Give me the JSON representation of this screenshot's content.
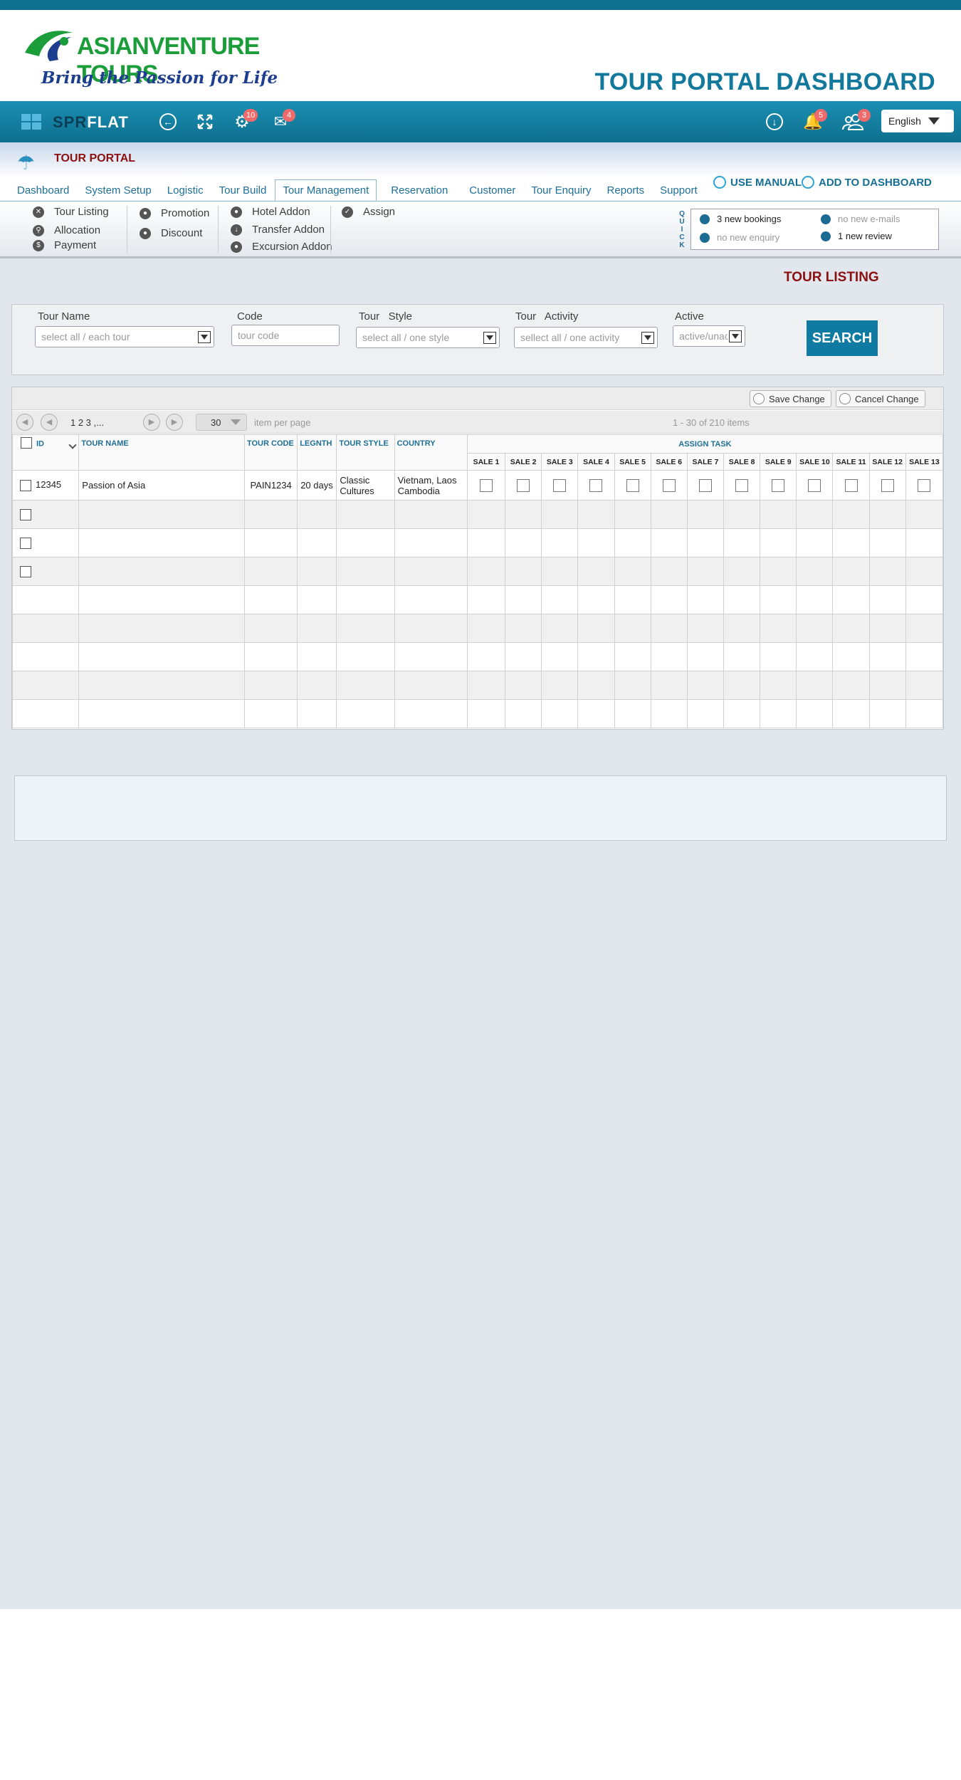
{
  "brand": {
    "logo_text": "ASIANVENTURE TOURS",
    "tagline": "Bring the Passion for Life",
    "dashboard_title": "TOUR PORTAL DASHBOARD"
  },
  "navbar": {
    "app_name_a": "SPR",
    "app_name_b": "FLAT",
    "settings_badge": "10",
    "mail_badge": "4",
    "notifications_badge": "5",
    "users_badge": "3",
    "language": "English"
  },
  "portal": {
    "label": "TOUR PORTAL",
    "tabs": [
      "Dashboard",
      "System Setup",
      "Logistic",
      "Tour Build",
      "Tour Management",
      "Reservation",
      "Customer",
      "Tour Enquiry",
      "Reports",
      "Support"
    ],
    "active_tab": "Tour Management",
    "use_manual": "USE MANUAL",
    "add_to_dashboard": "ADD TO  DASHBOARD"
  },
  "submenu": {
    "col1": [
      "Tour Listing",
      "Allocation",
      "Payment"
    ],
    "col2": [
      "Promotion",
      "Discount"
    ],
    "col3": [
      "Hotel Addon",
      "Transfer Addon",
      "Excursion Addon"
    ],
    "col4": [
      "Assign"
    ]
  },
  "quick": {
    "label": "QUICK",
    "items": [
      "3 new bookings",
      "no new e-mails",
      "no new enquiry",
      "1 new review"
    ]
  },
  "page": {
    "title": "TOUR LISTING"
  },
  "filters": {
    "tour_name_label": "Tour Name",
    "tour_name_value": "select all / each tour",
    "code_label": "Code",
    "code_placeholder": "tour code",
    "style_label": "Tour   Style",
    "style_value": "select all / one  style",
    "activity_label": "Tour   Activity",
    "activity_value": "sellect all  / one activity",
    "active_label": "Active",
    "active_value": "active/unactive",
    "search_label": "SEARCH"
  },
  "grid": {
    "save_change": "Save Change",
    "cancel_change": "Cancel Change",
    "pages": "1  2  3 ,...",
    "per_page_value": "30",
    "per_page_label": "item per page",
    "range": "1 - 30   of 210 items",
    "headers": {
      "id": "ID",
      "tour_name": "TOUR  NAME",
      "tour_code": "TOUR CODE",
      "length": "LEGNTH",
      "tour_style": "TOUR  STYLE",
      "country": "COUNTRY",
      "assign_task": "ASSIGN TASK"
    },
    "sales": [
      "SALE 1",
      "SALE 2",
      "SALE 3",
      "SALE 4",
      "SALE 5",
      "SALE 6",
      "SALE 7",
      "SALE 8",
      "SALE 9",
      "SALE 10",
      "SALE 11",
      "SALE 12",
      "SALE 13"
    ],
    "row1": {
      "id": "12345",
      "tour_name": "Passion of Asia",
      "tour_code": "PAIN1234",
      "length": "20 days",
      "tour_style": "Classic Cultures",
      "country": "Vietnam, Laos Cambodia"
    }
  },
  "colors": {
    "brand_teal": "#0f7aa2",
    "title_red": "#8b1010",
    "logo_green": "#1b9d3a",
    "badge_red": "#ef6a6a"
  }
}
